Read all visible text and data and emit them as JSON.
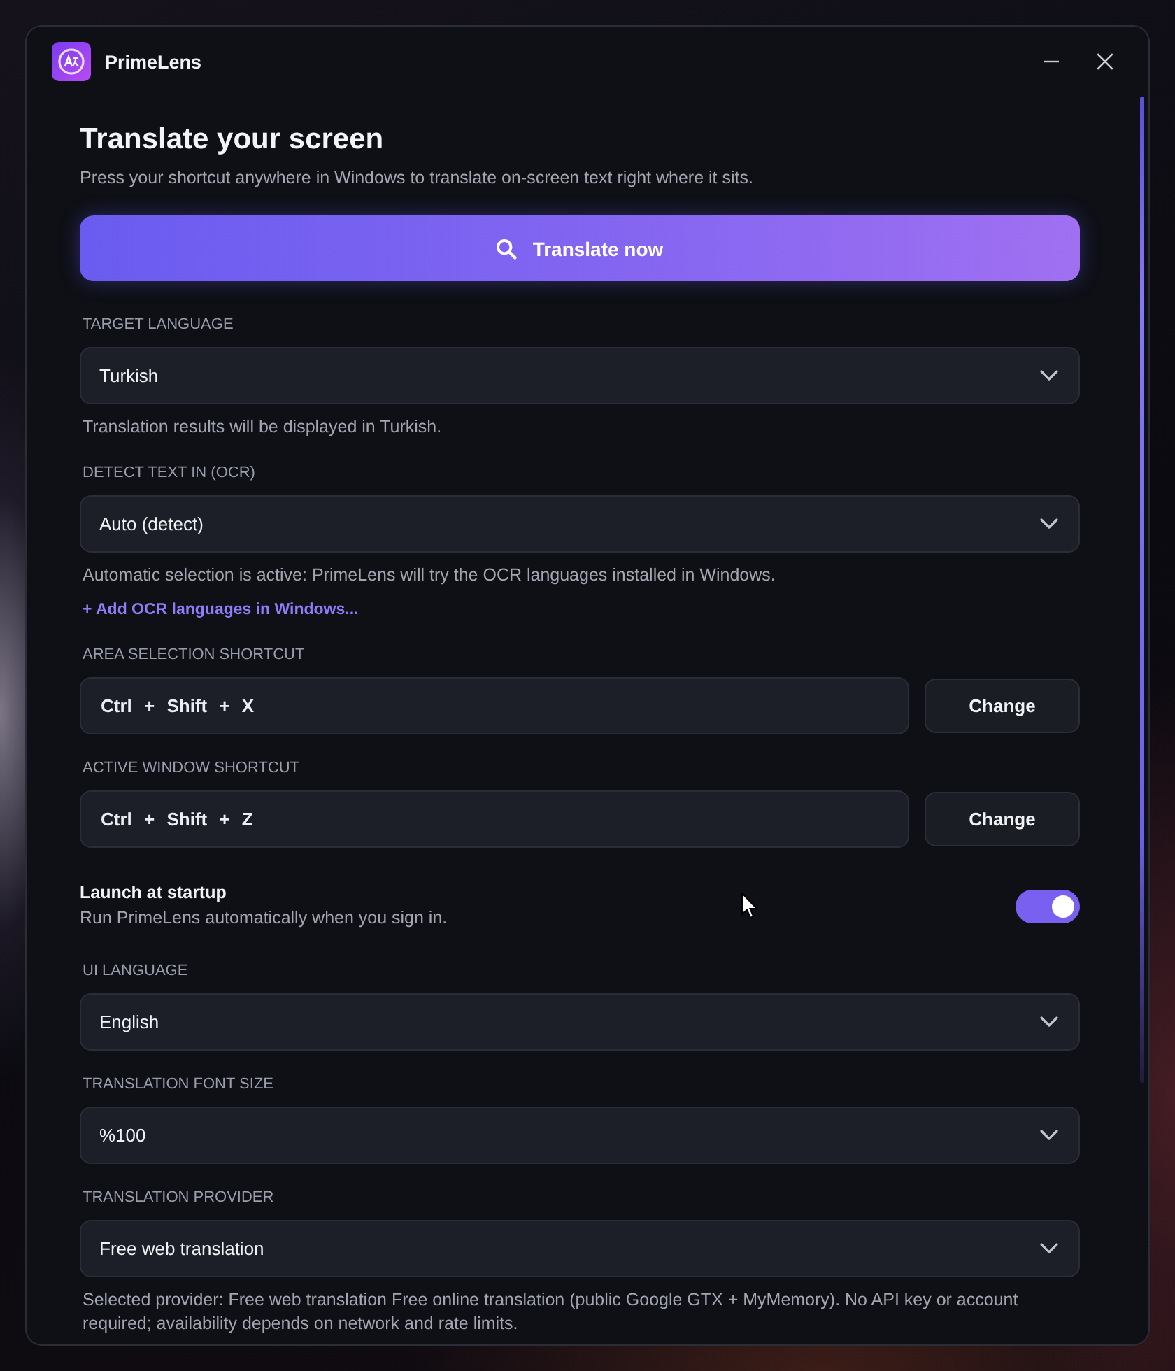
{
  "window": {
    "title": "PrimeLens"
  },
  "header": {
    "title": "Translate your screen",
    "subtitle": "Press your shortcut anywhere in Windows to translate on-screen text right where it sits."
  },
  "primary_button": {
    "label": "Translate now"
  },
  "settings": [
    {
      "kind": "select",
      "label": "TARGET LANGUAGE",
      "value": "Turkish",
      "help": "Translation results will be displayed in Turkish."
    },
    {
      "kind": "select",
      "label": "DETECT TEXT IN (OCR)",
      "value": "Auto (detect)",
      "help": "Automatic selection is active: PrimeLens will try the OCR languages installed in Windows.",
      "link": "+ Add OCR languages in Windows..."
    },
    {
      "kind": "shortcut",
      "label": "AREA SELECTION SHORTCUT",
      "value": "Ctrl + Shift + X",
      "button": "Change"
    },
    {
      "kind": "shortcut",
      "label": "ACTIVE WINDOW SHORTCUT",
      "value": "Ctrl + Shift + Z",
      "button": "Change"
    },
    {
      "kind": "toggle",
      "label": "Launch at startup",
      "description": "Run PrimeLens automatically when you sign in.",
      "on": true
    },
    {
      "kind": "select",
      "label": "UI LANGUAGE",
      "value": "English"
    },
    {
      "kind": "select",
      "label": "TRANSLATION FONT SIZE",
      "value": "%100"
    },
    {
      "kind": "select",
      "label": "TRANSLATION PROVIDER",
      "value": "Free web translation",
      "help": "Selected provider: Free web translation Free online translation (public Google GTX + MyMemory). No API key or account required; availability depends on network and rate limits."
    }
  ]
}
